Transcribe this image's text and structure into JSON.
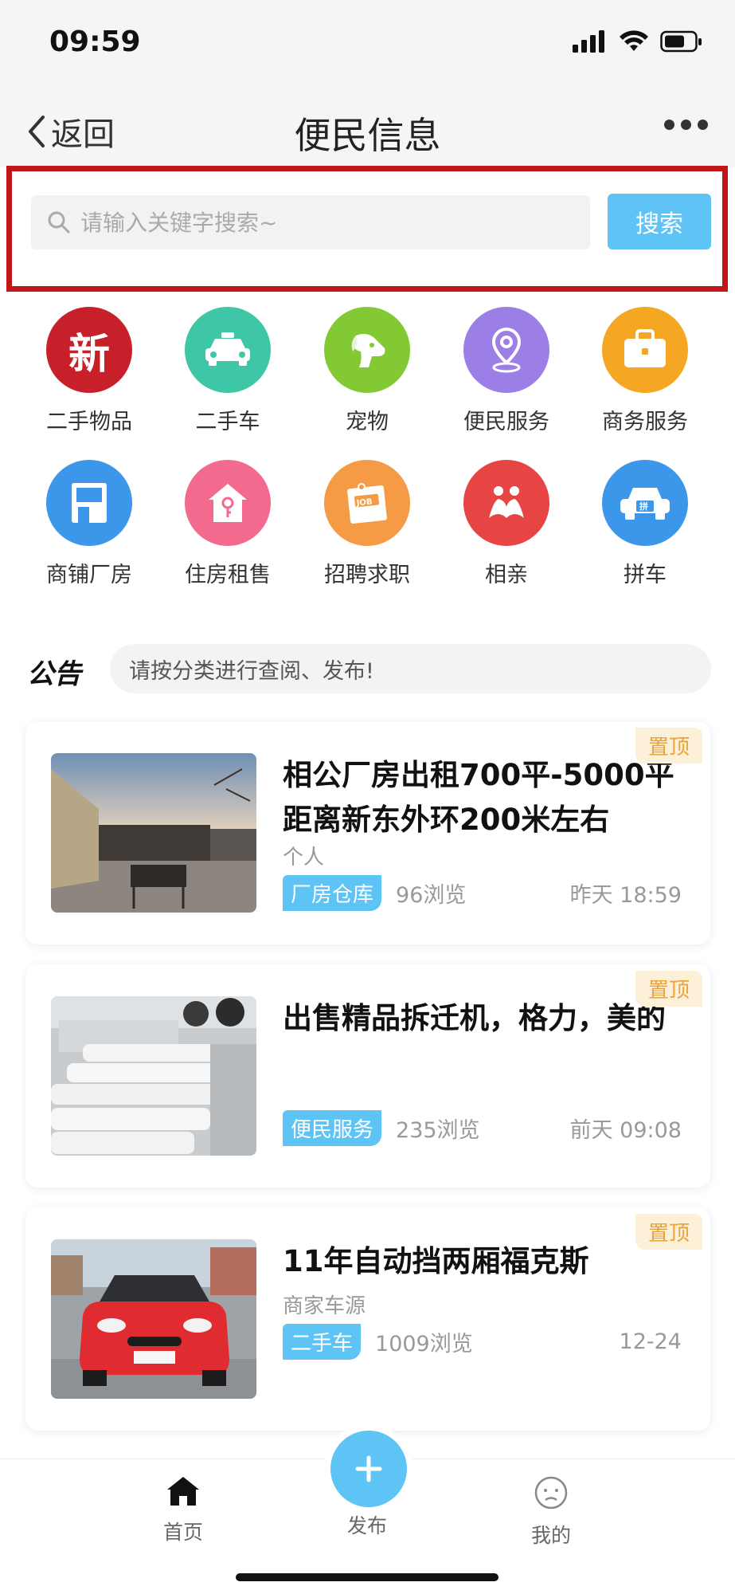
{
  "status_bar": {
    "time": "09:59"
  },
  "nav": {
    "back_label": "返回",
    "title": "便民信息"
  },
  "search": {
    "placeholder": "请输入关键字搜索~",
    "button_label": "搜索"
  },
  "categories": [
    {
      "label": "二手物品",
      "icon": "new-goods-icon",
      "color": "#c8202a"
    },
    {
      "label": "二手车",
      "icon": "taxi-car-icon",
      "color": "#3fc6a6"
    },
    {
      "label": "宠物",
      "icon": "dog-icon",
      "color": "#83c934"
    },
    {
      "label": "便民服务",
      "icon": "location-pin-icon",
      "color": "#9b7ee6"
    },
    {
      "label": "商务服务",
      "icon": "briefcase-icon",
      "color": "#f5a623"
    },
    {
      "label": "商铺厂房",
      "icon": "shop-icon",
      "color": "#3c97ea"
    },
    {
      "label": "住房租售",
      "icon": "house-key-icon",
      "color": "#f26b8f"
    },
    {
      "label": "招聘求职",
      "icon": "job-board-icon",
      "color": "#f59a45"
    },
    {
      "label": "相亲",
      "icon": "couple-icon",
      "color": "#e74444"
    },
    {
      "label": "拼车",
      "icon": "carpool-icon",
      "color": "#3c97ea"
    }
  ],
  "notice": {
    "logo": "公告",
    "text": "请按分类进行查阅、发布!"
  },
  "listings": [
    {
      "title": "相公厂房出租700平-5000平距离新东外环200米左右",
      "subtitle": "个人",
      "tag": "厂房仓库",
      "views": "96浏览",
      "time": "昨天 18:59",
      "badge": "置顶"
    },
    {
      "title": "出售精品拆迁机，格力，美的",
      "subtitle": "",
      "tag": "便民服务",
      "views": "235浏览",
      "time": "前天 09:08",
      "badge": "置顶"
    },
    {
      "title": "11年自动挡两厢福克斯",
      "subtitle": "商家车源",
      "tag": "二手车",
      "views": "1009浏览",
      "time": "12-24",
      "badge": "置顶"
    }
  ],
  "tabbar": {
    "home_label": "首页",
    "publish_label": "发布",
    "mine_label": "我的"
  },
  "colors": {
    "accent": "#5ec3f5",
    "highlight_frame": "#c2151a",
    "badge_text": "#e8a43b"
  }
}
